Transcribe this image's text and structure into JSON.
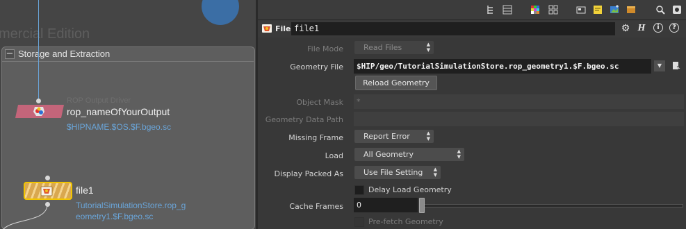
{
  "network": {
    "watermark": "mercial Edition",
    "netbox_title": "Storage and Extraction",
    "collapse_symbol": "−",
    "rop_node": {
      "type_label": "ROP Output Driver",
      "name": "rop_nameOfYourOutput",
      "path": "$HIPNAME.$OS.$F.bgeo.sc"
    },
    "file_node": {
      "name": "file1",
      "path_line1": "TutorialSimulationStore.rop_g",
      "path_line2": "eometry1.$F.bgeo.sc"
    }
  },
  "toolbar": {
    "icons": [
      "tree-view-icon",
      "list-view-icon",
      "color-palette-icon",
      "grid-layout-icon",
      "network-view-icon",
      "sticky-note-icon",
      "image-icon",
      "box-icon",
      "search-icon",
      "visibility-icon"
    ]
  },
  "param_pane": {
    "node_type_label": "File",
    "node_name": "file1",
    "header_buttons": {
      "gear": "⚙",
      "help_h": "H",
      "info": "i",
      "question": "?"
    },
    "params": {
      "file_mode": {
        "label": "File Mode",
        "value": "Read Files"
      },
      "geometry_file": {
        "label": "Geometry File",
        "value": "$HIP/geo/TutorialSimulationStore.rop_geometry1.$F.bgeo.sc"
      },
      "reload_geometry": {
        "label": "Reload Geometry"
      },
      "object_mask": {
        "label": "Object Mask",
        "value": "*"
      },
      "geometry_data_path": {
        "label": "Geometry Data Path",
        "value": ""
      },
      "missing_frame": {
        "label": "Missing Frame",
        "value": "Report Error"
      },
      "load": {
        "label": "Load",
        "value": "All Geometry"
      },
      "display_packed_as": {
        "label": "Display Packed As",
        "value": "Use File Setting"
      },
      "delay_load_geometry": {
        "label": "Delay Load Geometry",
        "checked": false
      },
      "cache_frames": {
        "label": "Cache Frames",
        "value": "0"
      },
      "prefetch_geometry": {
        "label": "Pre-fetch Geometry",
        "checked": false
      }
    }
  },
  "colors": {
    "link_blue": "#6aa5d9",
    "selection_yellow": "#f2c500",
    "rop_pink": "#c4657a"
  }
}
